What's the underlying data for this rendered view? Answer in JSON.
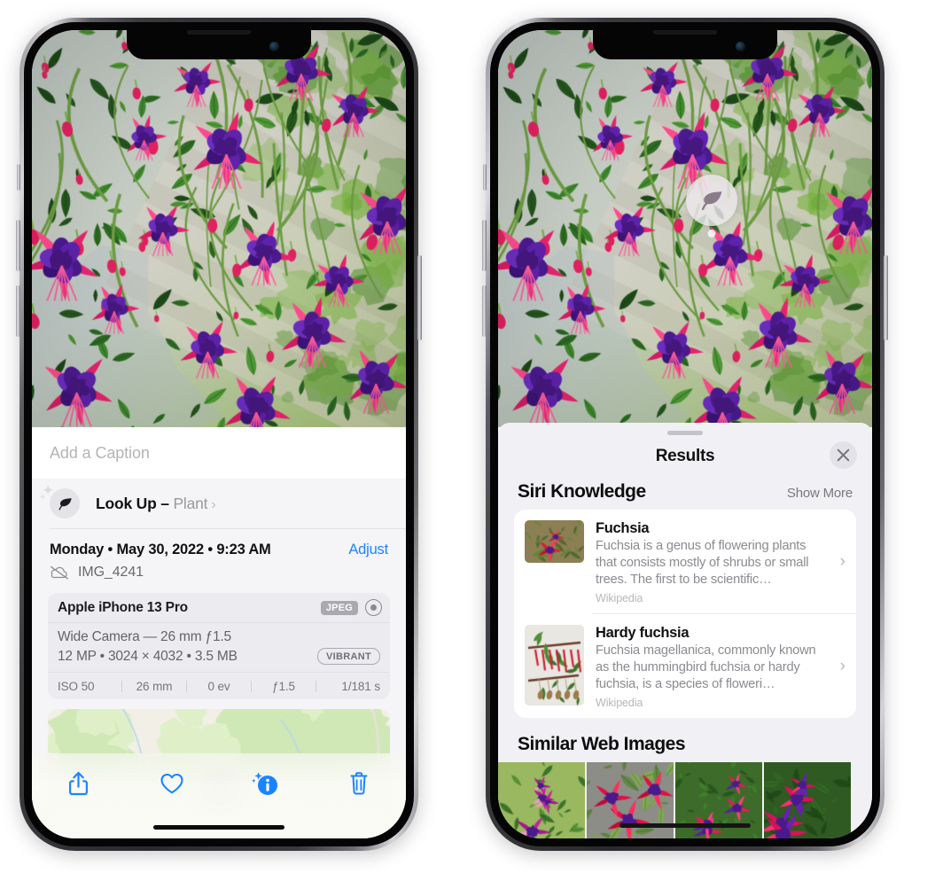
{
  "left_phone": {
    "caption_placeholder": "Add a Caption",
    "lookup": {
      "label": "Look Up",
      "dash": " – ",
      "subject": "Plant",
      "chevron": "›",
      "icon": "leaf-icon"
    },
    "date": "Monday • May 30, 2022 • 9:23 AM",
    "adjust_label": "Adjust",
    "filename": "IMG_4241",
    "cloud_icon": "icloud-slash-icon",
    "camera_card": {
      "device": "Apple iPhone 13 Pro",
      "format_badge": "JPEG",
      "lens_line": "Wide Camera — 26 mm ƒ1.5",
      "spec_line": "12 MP • 3024 × 4032 • 3.5 MB",
      "profile_badge": "VIBRANT",
      "exif": [
        "ISO 50",
        "26 mm",
        "0 ev",
        "ƒ1.5",
        "1/181 s"
      ]
    },
    "toolbar": [
      {
        "name": "share-button",
        "icon": "share-icon"
      },
      {
        "name": "favorite-button",
        "icon": "heart-icon"
      },
      {
        "name": "info-button",
        "icon": "info-sparkle-icon"
      },
      {
        "name": "delete-button",
        "icon": "trash-icon"
      }
    ]
  },
  "right_phone": {
    "visual_lookup_badge_icon": "leaf-icon",
    "sheet": {
      "title": "Results",
      "close_label": "✕",
      "sections": [
        {
          "title": "Siri Knowledge",
          "action": "Show More",
          "items": [
            {
              "title": "Fuchsia",
              "description": "Fuchsia is a genus of flowering plants that consists mostly of shrubs or small trees. The first to be scientific…",
              "source": "Wikipedia",
              "chevron": "›"
            },
            {
              "title": "Hardy fuchsia",
              "description": "Fuchsia magellanica, commonly known as the hummingbird fuchsia or hardy fuchsia, is a species of floweri…",
              "source": "Wikipedia",
              "chevron": "›"
            }
          ]
        },
        {
          "title": "Similar Web Images",
          "items": []
        }
      ]
    }
  },
  "colors": {
    "accent_blue": "#1a84ff",
    "sheet_bg": "#f1f1f5",
    "card_bg": "#ffffff",
    "secondary_text": "#8b8b91"
  }
}
